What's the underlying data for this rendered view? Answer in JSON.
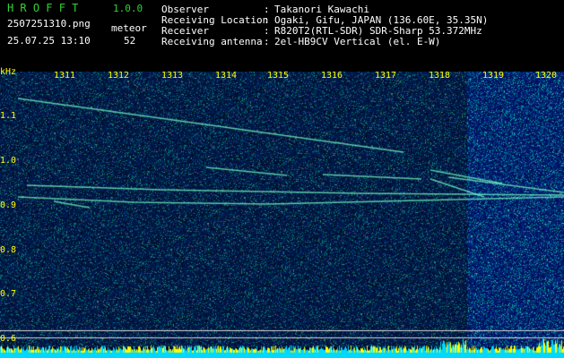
{
  "app": {
    "name": "HROFFT",
    "version": "1.0.0",
    "file_name": "2507251310.png",
    "timestamp": "25.07.25 13:10",
    "meteor_label": "meteor",
    "meteor_count": "52"
  },
  "station": [
    {
      "label": "Observer",
      "value": "Takanori Kawachi"
    },
    {
      "label": "Receiving Location",
      "value": "Ogaki, Gifu, JAPAN (136.60E, 35.35N)"
    },
    {
      "label": "Receiver",
      "value": "R820T2(RTL-SDR) SDR-Sharp 53.372MHz"
    },
    {
      "label": "Receiving antenna",
      "value": "2el-HB9CV Vertical (el. E-W)"
    }
  ],
  "separator": ":",
  "spectrogram": {
    "y_unit": "kHz",
    "y_ticks": [
      "1.1",
      "1.0",
      "0.9",
      "0.8",
      "0.7",
      "0.6"
    ],
    "time_ticks": [
      "1311",
      "1312",
      "1313",
      "1314",
      "1315",
      "1316",
      "1317",
      "1318",
      "1319",
      "1320"
    ],
    "colors": {
      "label": "#ffff00",
      "header_text": "#32d232",
      "trace": "#7fffd4",
      "baseline": "#00d8ff"
    }
  }
}
